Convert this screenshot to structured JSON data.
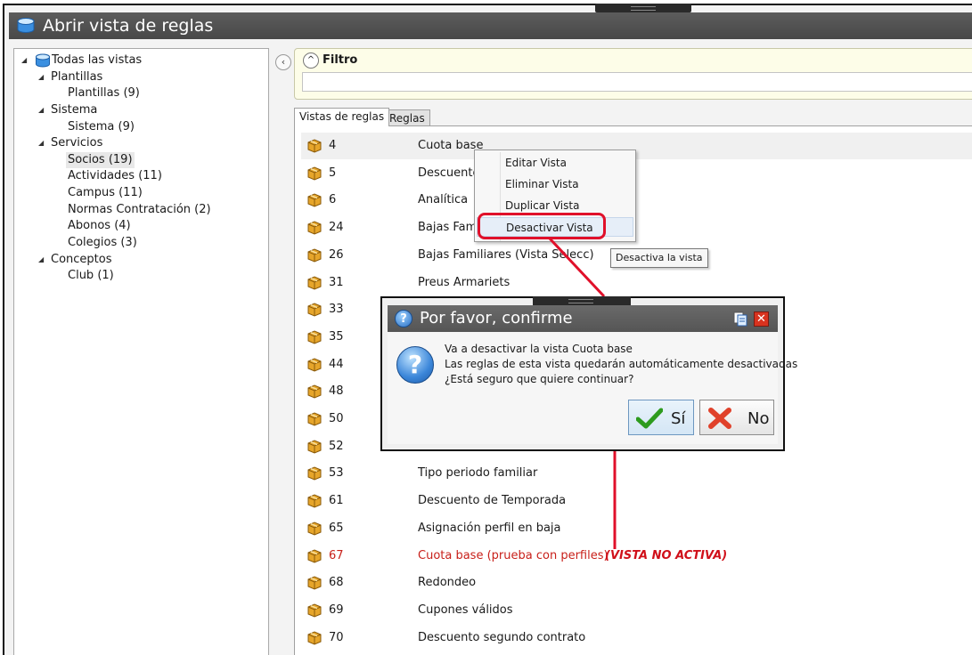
{
  "window": {
    "title": "Abrir vista de reglas",
    "icon": "database-icon"
  },
  "tree": {
    "root": "Todas las vistas",
    "groups": [
      {
        "label": "Plantillas",
        "children": [
          "Plantillas (9)"
        ]
      },
      {
        "label": "Sistema",
        "children": [
          "Sistema (9)"
        ]
      },
      {
        "label": "Servicios",
        "children": [
          "Socios (19)",
          "Actividades (11)",
          "Campus (11)",
          "Normas Contratación (2)",
          "Abonos (4)",
          "Colegios (3)"
        ]
      },
      {
        "label": "Conceptos",
        "children": [
          "Club (1)"
        ]
      }
    ],
    "selected": "Socios (19)"
  },
  "filter": {
    "label": "Filtro",
    "value": ""
  },
  "tabs": [
    {
      "label": "Vistas de reglas",
      "active": true
    },
    {
      "label": "Reglas",
      "active": false
    }
  ],
  "rules": [
    {
      "id": "4",
      "name": "Cuota base"
    },
    {
      "id": "5",
      "name": "Descuento"
    },
    {
      "id": "6",
      "name": "Analítica"
    },
    {
      "id": "24",
      "name": "Bajas Fami"
    },
    {
      "id": "26",
      "name": "Bajas Familiares (Vista Selecc)"
    },
    {
      "id": "31",
      "name": "Preus Armariets"
    },
    {
      "id": "33",
      "name": ""
    },
    {
      "id": "35",
      "name": ""
    },
    {
      "id": "44",
      "name": ""
    },
    {
      "id": "48",
      "name": ""
    },
    {
      "id": "50",
      "name": ""
    },
    {
      "id": "52",
      "name": ""
    },
    {
      "id": "53",
      "name": "Tipo periodo familiar"
    },
    {
      "id": "61",
      "name": "Descuento de Temporada"
    },
    {
      "id": "65",
      "name": "Asignación perfil en baja"
    },
    {
      "id": "67",
      "name": "Cuota base (prueba con perfiles)",
      "inactive": true
    },
    {
      "id": "68",
      "name": "Redondeo"
    },
    {
      "id": "69",
      "name": "Cupones válidos"
    },
    {
      "id": "70",
      "name": "Descuento segundo contrato"
    }
  ],
  "inactive_note": "(VISTA NO ACTIVA)",
  "context_menu": {
    "items": [
      "Editar Vista",
      "Eliminar Vista",
      "Duplicar Vista",
      "Desactivar Vista"
    ],
    "highlighted": "Desactivar Vista"
  },
  "tooltip": "Desactiva la vista",
  "dialog": {
    "title": "Por favor, confirme",
    "lines": [
      "Va a desactivar la vista Cuota base",
      "Las reglas de esta vista quedarán automáticamente desactivadas",
      "¿Está seguro que quiere continuar?"
    ],
    "yes_label": "Sí",
    "no_label": "No"
  },
  "colors": {
    "annotation_red": "#e0102a",
    "inactive_text": "#c8201a",
    "titlebar": "#4f4f4f"
  }
}
